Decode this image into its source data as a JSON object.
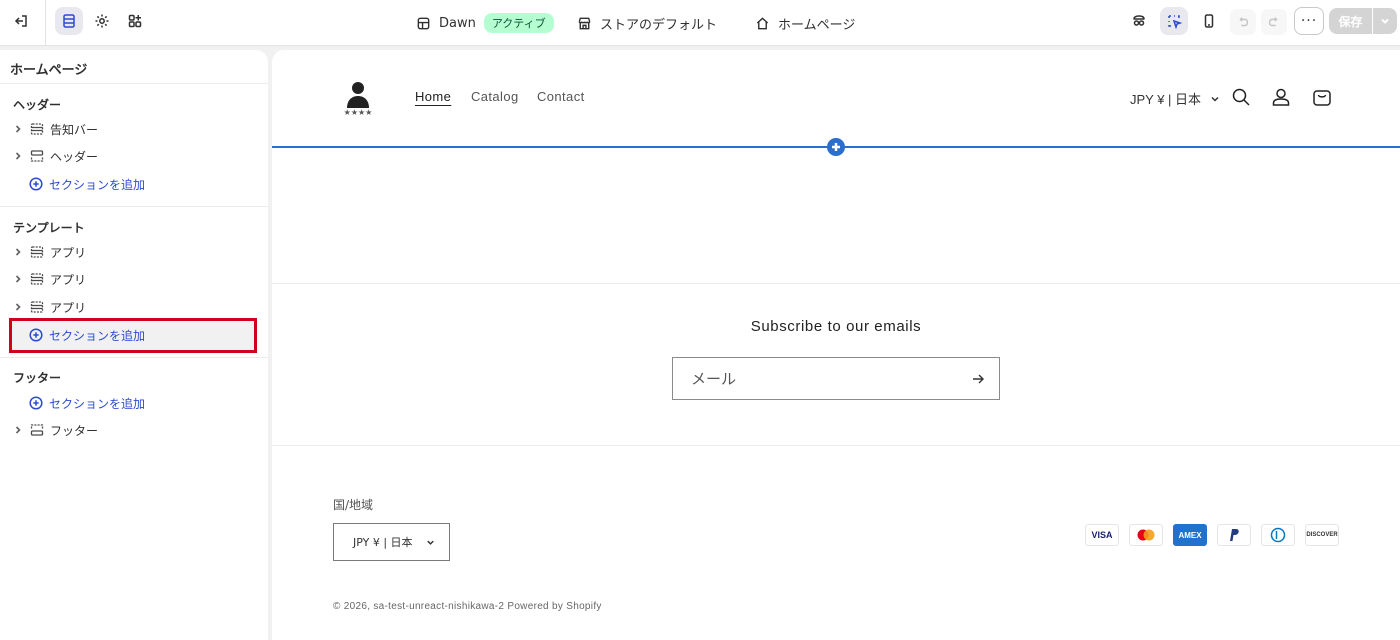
{
  "topbar": {
    "theme_name": "Dawn",
    "theme_status": "アクティブ",
    "store_default": "ストアのデフォルト",
    "page_selector": "ホームページ",
    "more_label": "···",
    "save_label": "保存"
  },
  "sidebar": {
    "title": "ホームページ",
    "groups": {
      "header": "ヘッダー",
      "template": "テンプレート",
      "footer": "フッター"
    },
    "header_items": [
      "告知バー",
      "ヘッダー"
    ],
    "template_items": [
      "アプリ",
      "アプリ",
      "アプリ"
    ],
    "footer_items": [
      "フッター"
    ],
    "add_section": "セクションを追加"
  },
  "preview": {
    "logo_caption": "★★★★",
    "nav": [
      "Home",
      "Catalog",
      "Contact"
    ],
    "currency": "JPY ¥ | 日本",
    "subscribe_title": "Subscribe to our emails",
    "email_placeholder": "メール",
    "country_label": "国/地域",
    "country_value": "JPY ¥ | 日本",
    "payment_methods": [
      "VISA",
      "Mastercard",
      "AMEX",
      "PayPal",
      "Diners",
      "DISCOVER"
    ],
    "copyright": "© 2026, sa-test-unreact-nishikawa-2 Powered by Shopify"
  },
  "colors": {
    "accent": "#2b4ad3",
    "preview_line": "#2c6ecb",
    "highlight": "#d0021b",
    "badge_bg": "#b4fed2"
  }
}
